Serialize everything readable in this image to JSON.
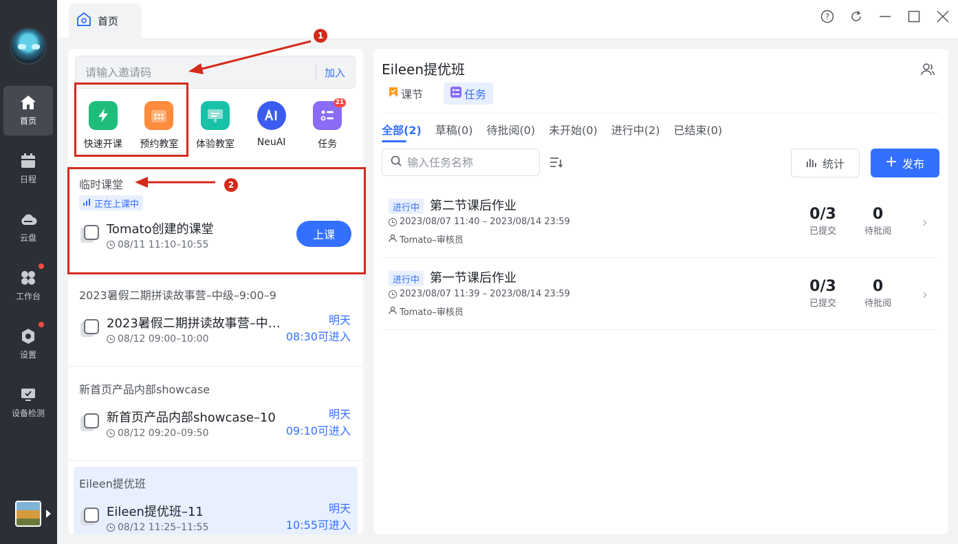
{
  "sidebar": {
    "items": [
      {
        "label": "首页",
        "icon": "home-icon"
      },
      {
        "label": "日程",
        "icon": "calendar-icon"
      },
      {
        "label": "云盘",
        "icon": "cloud-icon"
      },
      {
        "label": "工作台",
        "icon": "workbench-icon"
      },
      {
        "label": "设置",
        "icon": "settings-icon"
      },
      {
        "label": "设备检测",
        "icon": "device-check-icon"
      }
    ]
  },
  "tabbar": {
    "tab_label": "首页"
  },
  "left": {
    "invite_placeholder": "请输入邀请码",
    "join_label": "加入",
    "apps": [
      {
        "label": "快速开课",
        "icon": "quick-class-icon",
        "color": "#1fbd7a"
      },
      {
        "label": "预约教室",
        "icon": "book-room-icon",
        "color": "#ff8b3d"
      },
      {
        "label": "体验教室",
        "icon": "trial-room-icon",
        "color": "#18c2a8"
      },
      {
        "label": "NeuAI",
        "icon": "neuai-icon",
        "color": "#3a5cf0"
      },
      {
        "label": "任务",
        "icon": "tasks-icon",
        "color": "#8b6cf6",
        "badge": "21"
      }
    ],
    "temp_section_title": "临时课堂",
    "live_tag": "正在上课中",
    "temp_class": {
      "name": "Tomato创建的课堂",
      "time": "08/11 11:10–10:55",
      "button": "上课"
    },
    "groups": [
      {
        "title": "2023暑假二期拼读故事营–中级–9:00–9",
        "name": "2023暑假二期拼读故事营–中…",
        "time": "08/12 09:00–10:00",
        "day": "明天",
        "enter": "08:30可进入"
      },
      {
        "title": "新首页产品内部showcase",
        "name": "新首页产品内部showcase–10",
        "time": "08/12 09:20–09:50",
        "day": "明天",
        "enter": "09:10可进入"
      },
      {
        "title": "Eileen提优班",
        "name": "Eileen提优班–11",
        "time": "08/12 11:25–11:55",
        "day": "明天",
        "enter": "10:55可进入"
      }
    ],
    "annotations": [
      "1",
      "2"
    ]
  },
  "right": {
    "title": "Eileen提优班",
    "subtabs": [
      "课节",
      "任务"
    ],
    "filters": [
      "全部(2)",
      "草稿(0)",
      "待批阅(0)",
      "未开始(0)",
      "进行中(2)",
      "已结束(0)"
    ],
    "search_placeholder": "输入任务名称",
    "stats_label": "统计",
    "publish_label": "发布",
    "tasks": [
      {
        "status": "进行中",
        "name": "第二节课后作业",
        "date": "2023/08/07 11:40 – 2023/08/14 23:59",
        "user": "Tomato–审核员",
        "submitted": "0/3",
        "submitted_label": "已提交",
        "pending": "0",
        "pending_label": "待批阅"
      },
      {
        "status": "进行中",
        "name": "第一节课后作业",
        "date": "2023/08/07 11:39 – 2023/08/14 23:59",
        "user": "Tomato–审核员",
        "submitted": "0/3",
        "submitted_label": "已提交",
        "pending": "0",
        "pending_label": "待批阅"
      }
    ]
  },
  "colors": {
    "accent": "#3370ff",
    "sidebar_bg": "#2b2f36",
    "annotation": "#d42a1c"
  }
}
